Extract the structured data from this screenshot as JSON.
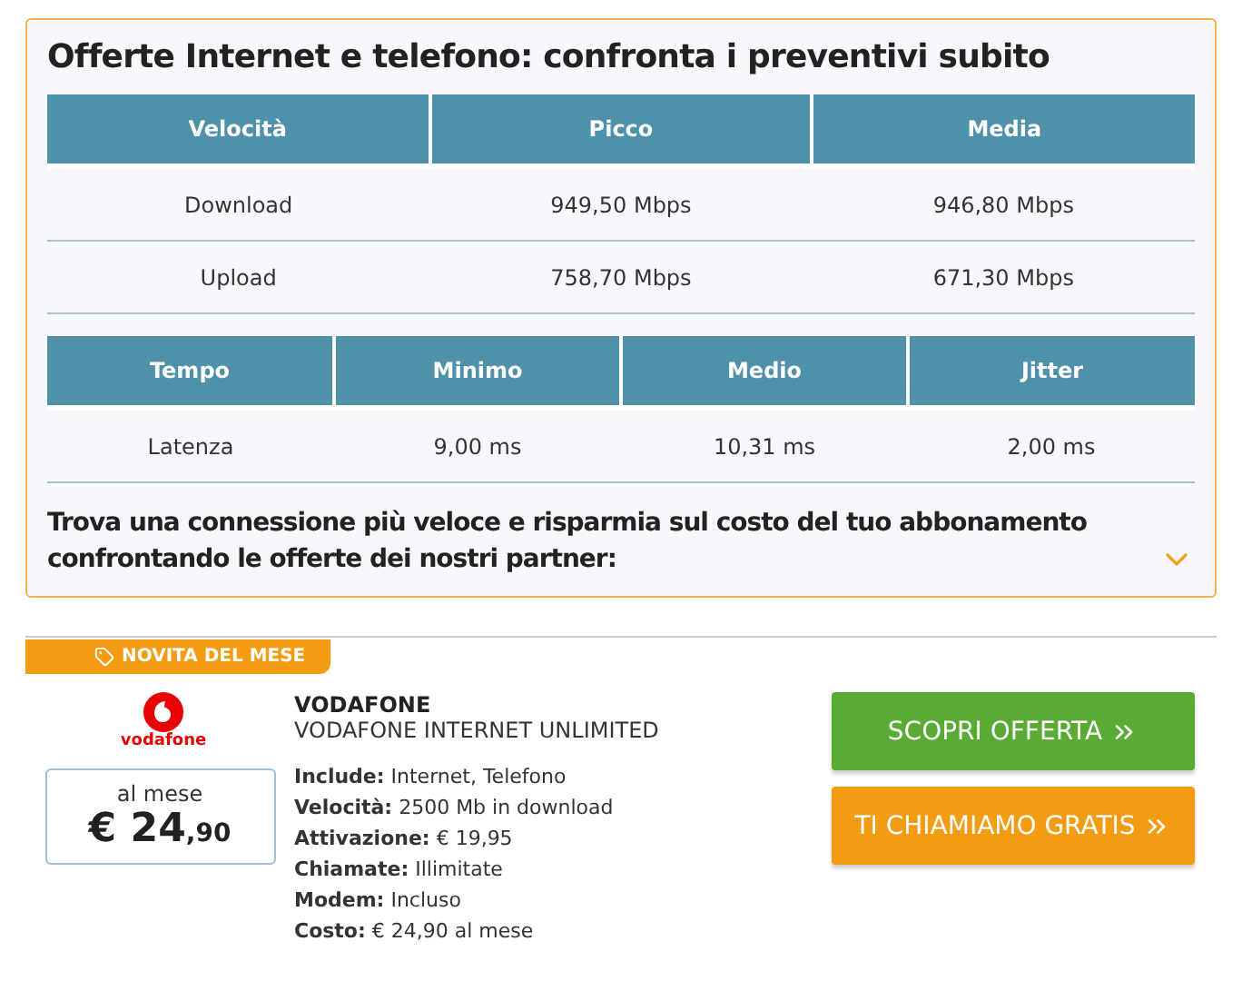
{
  "title": "Offerte Internet e telefono: confronta i preventivi subito",
  "speed_table": {
    "columns": [
      "Velocità",
      "Picco",
      "Media"
    ],
    "rows": [
      [
        "Download",
        "949,50 Mbps",
        "946,80 Mbps"
      ],
      [
        "Upload",
        "758,70 Mbps",
        "671,30 Mbps"
      ]
    ]
  },
  "latency_table": {
    "columns": [
      "Tempo",
      "Minimo",
      "Medio",
      "Jitter"
    ],
    "rows": [
      [
        "Latenza",
        "9,00 ms",
        "10,31 ms",
        "2,00 ms"
      ]
    ]
  },
  "promo_text": "Trova una connessione più veloce e risparmia sul costo del tuo abbonamento confrontando le offerte dei nostri partner:",
  "expanded": false,
  "offer": {
    "badge": "NOVITA DEL MESE",
    "logo_text": "vodafone",
    "price_label": "al mese",
    "price_main": "€ 24",
    "price_cents": ",90",
    "provider": "VODAFONE",
    "plan": "VODAFONE INTERNET UNLIMITED",
    "details": [
      "**Include:** Internet, Telefono",
      "**Velocità:** 2500 Mb in download",
      "**Attivazione:** € 19,95",
      "**Chiamate:** Illimitate",
      "**Modem:** Incluso",
      "**Costo:** € 24,90 al mese"
    ],
    "buttons": [
      {
        "label": "SCOPRI OFFERTA",
        "kind": "primary"
      },
      {
        "label": "TI CHIAMIAMO GRATIS",
        "kind": "secondary"
      }
    ]
  }
}
